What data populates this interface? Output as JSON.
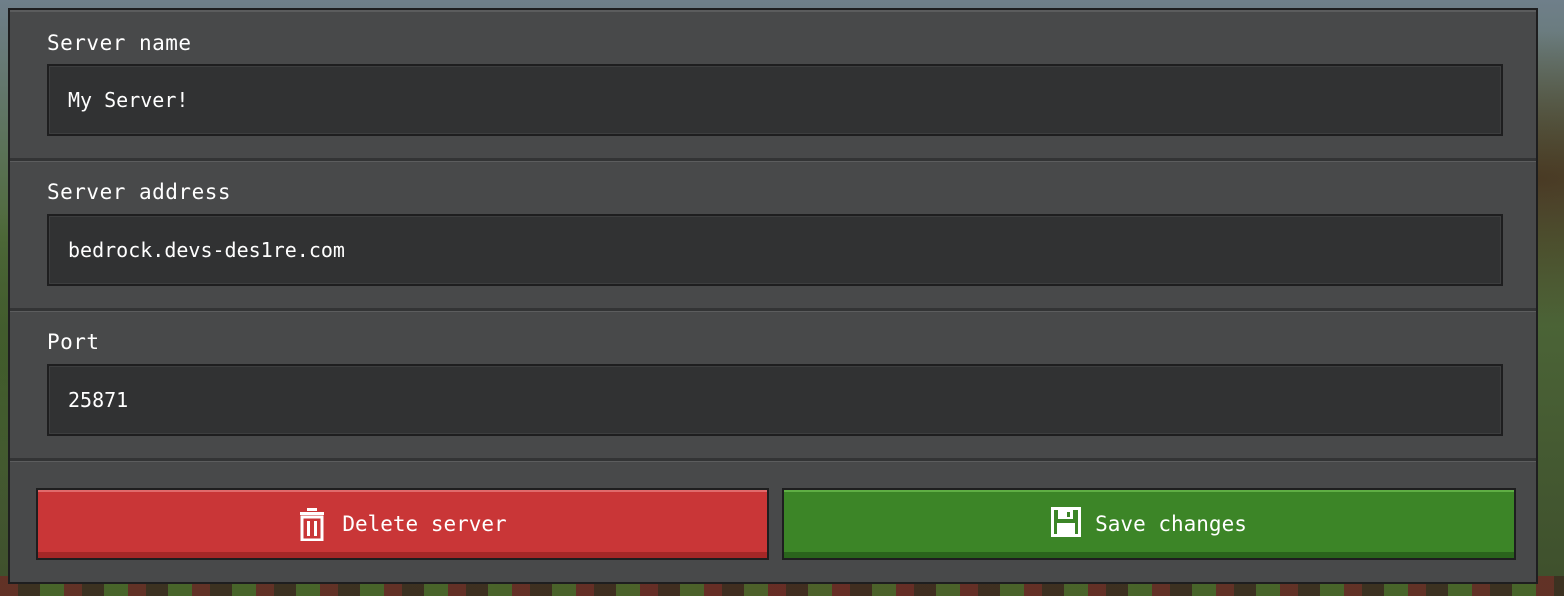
{
  "form": {
    "server_name": {
      "label": "Server name",
      "value": "My Server!"
    },
    "server_address": {
      "label": "Server address",
      "value": "bedrock.devs-des1re.com"
    },
    "port": {
      "label": "Port",
      "value": "25871"
    }
  },
  "actions": {
    "delete_label": "Delete server",
    "delete_icon": "trash-icon",
    "save_label": "Save changes",
    "save_icon": "floppy-disk-icon"
  },
  "colors": {
    "delete": "#c93637",
    "save": "#3c8527",
    "panel": "#48494a",
    "input": "#313233"
  }
}
